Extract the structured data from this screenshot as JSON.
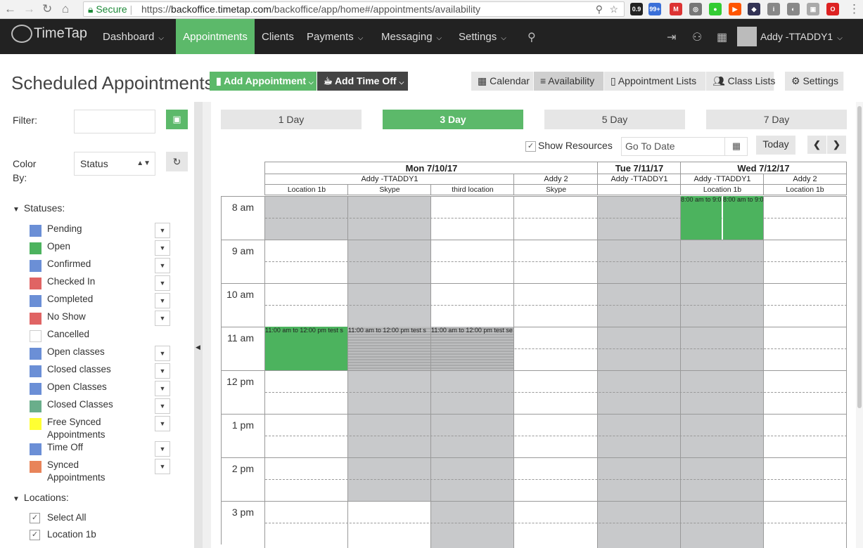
{
  "browser": {
    "secure_label": "Secure",
    "url_prefix": "https://",
    "url_host": "backoffice.timetap.com",
    "url_path": "/backoffice/app/home#/appointments/availability",
    "ext_badges": [
      "0.9",
      "99+"
    ]
  },
  "nav": {
    "logo": "TimeTap",
    "items": [
      "Dashboard",
      "Appointments",
      "Clients",
      "Payments",
      "Messaging",
      "Settings"
    ],
    "user": "Addy -TTADDY1"
  },
  "header": {
    "title": "Scheduled Appointments",
    "add_appointment": "Add Appointment",
    "add_time_off": "Add Time Off",
    "views": [
      "Calendar",
      "Availability",
      "Appointment Lists",
      "Class Lists"
    ],
    "settings": "Settings"
  },
  "sidebar": {
    "filter_label": "Filter:",
    "filter_value": "",
    "color_by_label": "Color By:",
    "color_by_value": "Status",
    "statuses_title": "Statuses:",
    "statuses": [
      {
        "label": "Pending",
        "color": "#6b8fd6"
      },
      {
        "label": "Open",
        "color": "#4cb35e"
      },
      {
        "label": "Confirmed",
        "color": "#6b8fd6"
      },
      {
        "label": "Checked In",
        "color": "#e06464"
      },
      {
        "label": "Completed",
        "color": "#6b8fd6"
      },
      {
        "label": "No Show",
        "color": "#e06464"
      },
      {
        "label": "Cancelled",
        "color": "#ffffff"
      },
      {
        "label": "Open classes",
        "color": "#6b8fd6"
      },
      {
        "label": "Closed classes",
        "color": "#6b8fd6"
      },
      {
        "label": "Open Classes",
        "color": "#6b8fd6"
      },
      {
        "label": "Closed Classes",
        "color": "#6aae8b"
      },
      {
        "label": "Free Synced Appointments",
        "color": "#ffff33"
      },
      {
        "label": "Time Off",
        "color": "#6b8fd6"
      },
      {
        "label": "Synced Appointments",
        "color": "#e8845a"
      }
    ],
    "locations_title": "Locations:",
    "locations": [
      "Select All",
      "Location 1b"
    ]
  },
  "toolbar": {
    "day_tabs": [
      "1 Day",
      "3 Day",
      "5 Day",
      "7 Day"
    ],
    "active_tab": "3 Day",
    "show_resources": "Show Resources",
    "goto_placeholder": "Go To Date",
    "today": "Today"
  },
  "calendar": {
    "days": [
      "Mon 7/10/17",
      "Tue 7/11/17",
      "Wed 7/12/17"
    ],
    "employees": [
      "Addy -TTADDY1",
      "Addy 2",
      "Addy -TTADDY1",
      "Addy -TTADDY1",
      "Addy 2"
    ],
    "locations": [
      "Location 1b",
      "Skype",
      "third location",
      "Skype",
      "",
      "Location 1b",
      "Location 1b"
    ],
    "times": [
      "8 am",
      "9 am",
      "10 am",
      "11 am",
      "12 pm",
      "1 pm",
      "2 pm",
      "3 pm"
    ],
    "appointments": [
      "11:00 am to 12:00 pm test s",
      "11:00 am to 12:00 pm test s",
      "11:00 am to 12:00 pm test se",
      "8:00 am to 9:0",
      "8:00 am to 9:0"
    ]
  }
}
